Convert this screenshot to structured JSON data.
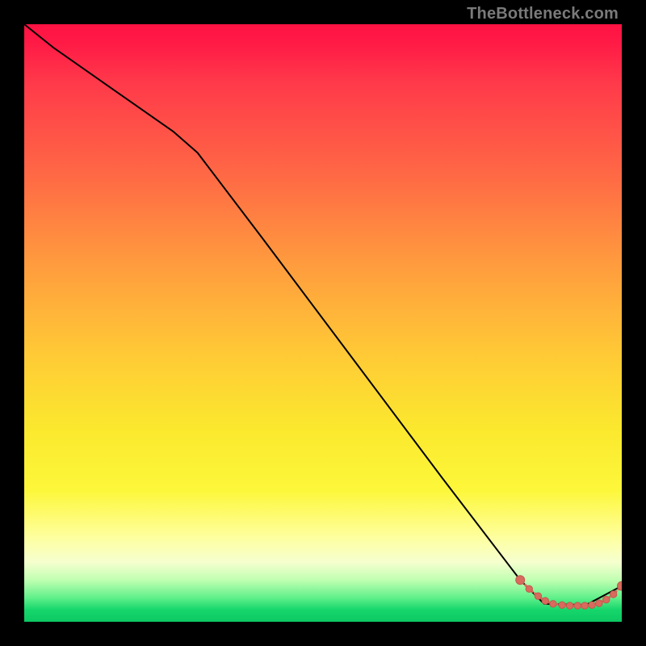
{
  "watermark": {
    "text": "TheBottleneck.com"
  },
  "colors": {
    "line": "#000000",
    "marker_fill": "#d86b5d",
    "marker_stroke": "#c25a4d"
  },
  "chart_data": {
    "type": "line",
    "title": "",
    "xlabel": "",
    "ylabel": "",
    "xlim": [
      0,
      100
    ],
    "ylim": [
      0,
      100
    ],
    "grid": false,
    "note": "Axes are not labeled in the image; x/y expressed as 0–100 percent of plot area (0,0 = bottom-left). Values estimated from pixel positions.",
    "series": [
      {
        "name": "curve",
        "kind": "line-only",
        "x": [
          0.0,
          5.0,
          15.0,
          25.0,
          29.0,
          40.0,
          55.0,
          70.0,
          83.0,
          87.0,
          94.0,
          100.0
        ],
        "y": [
          100.0,
          96.0,
          89.0,
          82.0,
          78.5,
          64.0,
          44.0,
          24.0,
          7.0,
          3.0,
          2.8,
          6.0
        ]
      },
      {
        "name": "markers",
        "kind": "points-dashed",
        "x": [
          83.0,
          84.5,
          86.0,
          87.2,
          88.5,
          90.0,
          91.3,
          92.6,
          93.8,
          95.0,
          96.2,
          97.4,
          98.6,
          100.0
        ],
        "y": [
          7.0,
          5.5,
          4.3,
          3.5,
          3.0,
          2.8,
          2.7,
          2.7,
          2.7,
          2.8,
          3.1,
          3.7,
          4.6,
          6.0
        ]
      }
    ]
  }
}
